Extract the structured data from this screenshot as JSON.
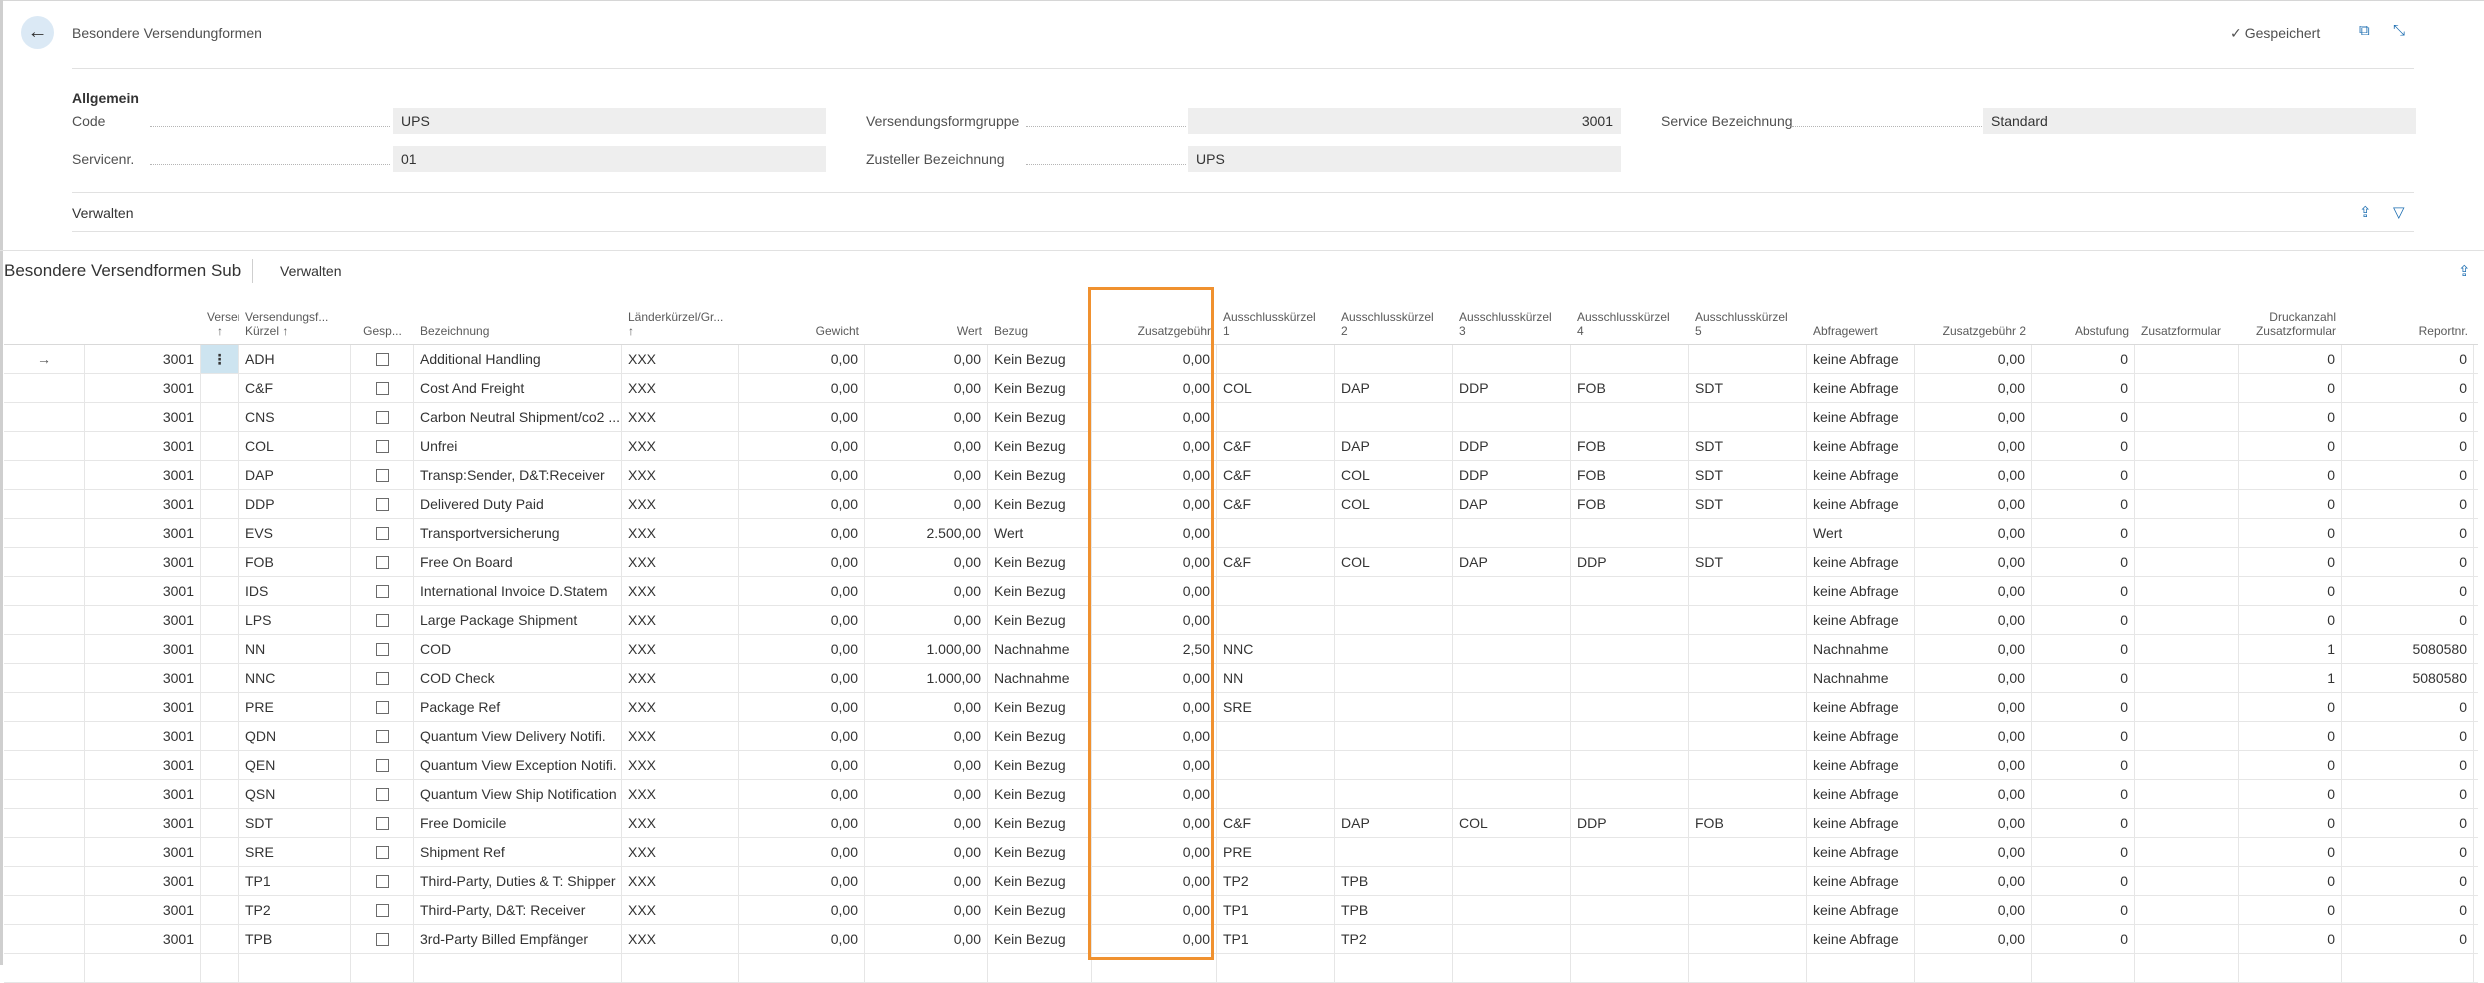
{
  "header": {
    "title": "Besondere Versendungformen",
    "saved_label": "Gespeichert",
    "icons": [
      "back-arrow-icon",
      "open-new-window-icon",
      "collapse-icon"
    ]
  },
  "general": {
    "title": "Allgemein",
    "fields": [
      {
        "label": "Code",
        "value": "UPS",
        "align": "left"
      },
      {
        "label": "Servicenr.",
        "value": "01",
        "align": "left"
      },
      {
        "label": "Versendungsformgruppe",
        "value": "3001",
        "align": "right"
      },
      {
        "label": "Zusteller Bezeichnung",
        "value": "UPS",
        "align": "left"
      },
      {
        "label": "Service Bezeichnung",
        "value": "Standard",
        "align": "left"
      }
    ],
    "manage_label": "Verwalten"
  },
  "sub": {
    "title": "Besondere Versendformen Sub",
    "manage_label": "Verwalten",
    "columns": [
      "",
      "",
      "Versendungsfor...\n↑",
      "Versendungsf...\nKürzel ↑",
      "Gesp...",
      "Bezeichnung",
      "Länderkürzel/Gr...\n↑",
      "Gewicht",
      "Wert",
      "Bezug",
      "Zusatzgebühr",
      "Ausschlusskürzel\n1",
      "Ausschlusskürzel\n2",
      "Ausschlusskürzel\n3",
      "Ausschlusskürzel\n4",
      "Ausschlusskürzel\n5",
      "Abfragewert",
      "Zusatzgebühr 2",
      "Abstufung",
      "Zusatzformular",
      "Druckanzahl\nZusatzformular",
      "Reportnr."
    ],
    "rows": [
      [
        "3001",
        "ADH",
        "Additional Handling",
        "XXX",
        "0,00",
        "0,00",
        "Kein Bezug",
        "0,00",
        "",
        "",
        "",
        "",
        "",
        "keine Abfrage",
        "0,00",
        "0",
        "",
        "0",
        "0"
      ],
      [
        "3001",
        "C&F",
        "Cost And Freight",
        "XXX",
        "0,00",
        "0,00",
        "Kein Bezug",
        "0,00",
        "COL",
        "DAP",
        "DDP",
        "FOB",
        "SDT",
        "keine Abfrage",
        "0,00",
        "0",
        "",
        "0",
        "0"
      ],
      [
        "3001",
        "CNS",
        "Carbon Neutral Shipment/co2 ...",
        "XXX",
        "0,00",
        "0,00",
        "Kein Bezug",
        "0,00",
        "",
        "",
        "",
        "",
        "",
        "keine Abfrage",
        "0,00",
        "0",
        "",
        "0",
        "0"
      ],
      [
        "3001",
        "COL",
        "Unfrei",
        "XXX",
        "0,00",
        "0,00",
        "Kein Bezug",
        "0,00",
        "C&F",
        "DAP",
        "DDP",
        "FOB",
        "SDT",
        "keine Abfrage",
        "0,00",
        "0",
        "",
        "0",
        "0"
      ],
      [
        "3001",
        "DAP",
        "Transp:Sender, D&T:Receiver",
        "XXX",
        "0,00",
        "0,00",
        "Kein Bezug",
        "0,00",
        "C&F",
        "COL",
        "DDP",
        "FOB",
        "SDT",
        "keine Abfrage",
        "0,00",
        "0",
        "",
        "0",
        "0"
      ],
      [
        "3001",
        "DDP",
        "Delivered Duty Paid",
        "XXX",
        "0,00",
        "0,00",
        "Kein Bezug",
        "0,00",
        "C&F",
        "COL",
        "DAP",
        "FOB",
        "SDT",
        "keine Abfrage",
        "0,00",
        "0",
        "",
        "0",
        "0"
      ],
      [
        "3001",
        "EVS",
        "Transportversicherung",
        "XXX",
        "0,00",
        "2.500,00",
        "Wert",
        "0,00",
        "",
        "",
        "",
        "",
        "",
        "Wert",
        "0,00",
        "0",
        "",
        "0",
        "0"
      ],
      [
        "3001",
        "FOB",
        "Free On Board",
        "XXX",
        "0,00",
        "0,00",
        "Kein Bezug",
        "0,00",
        "C&F",
        "COL",
        "DAP",
        "DDP",
        "SDT",
        "keine Abfrage",
        "0,00",
        "0",
        "",
        "0",
        "0"
      ],
      [
        "3001",
        "IDS",
        "International Invoice D.Statem",
        "XXX",
        "0,00",
        "0,00",
        "Kein Bezug",
        "0,00",
        "",
        "",
        "",
        "",
        "",
        "keine Abfrage",
        "0,00",
        "0",
        "",
        "0",
        "0"
      ],
      [
        "3001",
        "LPS",
        "Large Package Shipment",
        "XXX",
        "0,00",
        "0,00",
        "Kein Bezug",
        "0,00",
        "",
        "",
        "",
        "",
        "",
        "keine Abfrage",
        "0,00",
        "0",
        "",
        "0",
        "0"
      ],
      [
        "3001",
        "NN",
        "COD",
        "XXX",
        "0,00",
        "1.000,00",
        "Nachnahme",
        "2,50",
        "NNC",
        "",
        "",
        "",
        "",
        "Nachnahme",
        "0,00",
        "0",
        "",
        "1",
        "5080580"
      ],
      [
        "3001",
        "NNC",
        "COD Check",
        "XXX",
        "0,00",
        "1.000,00",
        "Nachnahme",
        "0,00",
        "NN",
        "",
        "",
        "",
        "",
        "Nachnahme",
        "0,00",
        "0",
        "",
        "1",
        "5080580"
      ],
      [
        "3001",
        "PRE",
        "Package Ref",
        "XXX",
        "0,00",
        "0,00",
        "Kein Bezug",
        "0,00",
        "SRE",
        "",
        "",
        "",
        "",
        "keine Abfrage",
        "0,00",
        "0",
        "",
        "0",
        "0"
      ],
      [
        "3001",
        "QDN",
        "Quantum View Delivery Notifi.",
        "XXX",
        "0,00",
        "0,00",
        "Kein Bezug",
        "0,00",
        "",
        "",
        "",
        "",
        "",
        "keine Abfrage",
        "0,00",
        "0",
        "",
        "0",
        "0"
      ],
      [
        "3001",
        "QEN",
        "Quantum View Exception Notifi.",
        "XXX",
        "0,00",
        "0,00",
        "Kein Bezug",
        "0,00",
        "",
        "",
        "",
        "",
        "",
        "keine Abfrage",
        "0,00",
        "0",
        "",
        "0",
        "0"
      ],
      [
        "3001",
        "QSN",
        "Quantum View Ship Notification",
        "XXX",
        "0,00",
        "0,00",
        "Kein Bezug",
        "0,00",
        "",
        "",
        "",
        "",
        "",
        "keine Abfrage",
        "0,00",
        "0",
        "",
        "0",
        "0"
      ],
      [
        "3001",
        "SDT",
        "Free Domicile",
        "XXX",
        "0,00",
        "0,00",
        "Kein Bezug",
        "0,00",
        "C&F",
        "DAP",
        "COL",
        "DDP",
        "FOB",
        "keine Abfrage",
        "0,00",
        "0",
        "",
        "0",
        "0"
      ],
      [
        "3001",
        "SRE",
        "Shipment Ref",
        "XXX",
        "0,00",
        "0,00",
        "Kein Bezug",
        "0,00",
        "PRE",
        "",
        "",
        "",
        "",
        "keine Abfrage",
        "0,00",
        "0",
        "",
        "0",
        "0"
      ],
      [
        "3001",
        "TP1",
        "Third-Party, Duties & T: Shipper",
        "XXX",
        "0,00",
        "0,00",
        "Kein Bezug",
        "0,00",
        "TP2",
        "TPB",
        "",
        "",
        "",
        "keine Abfrage",
        "0,00",
        "0",
        "",
        "0",
        "0"
      ],
      [
        "3001",
        "TP2",
        "Third-Party, D&T: Receiver",
        "XXX",
        "0,00",
        "0,00",
        "Kein Bezug",
        "0,00",
        "TP1",
        "TPB",
        "",
        "",
        "",
        "keine Abfrage",
        "0,00",
        "0",
        "",
        "0",
        "0"
      ],
      [
        "3001",
        "TPB",
        "3rd-Party Billed Empfänger",
        "XXX",
        "0,00",
        "0,00",
        "Kein Bezug",
        "0,00",
        "TP1",
        "TP2",
        "",
        "",
        "",
        "keine Abfrage",
        "0,00",
        "0",
        "",
        "0",
        "0"
      ]
    ],
    "current_row_indicator": "→",
    "row_menu_glyph": "⋮"
  },
  "colors": {
    "highlight": "#f0912f",
    "accent": "#1f6fb2",
    "back_button_bg": "#dbe9f5"
  }
}
